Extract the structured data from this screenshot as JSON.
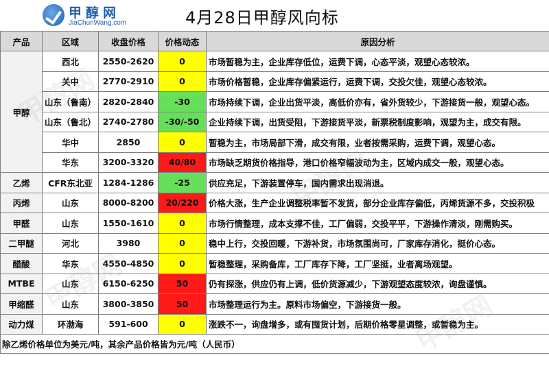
{
  "logo": {
    "cn": "甲醇网",
    "en": "JiaChunWang.com"
  },
  "title": "4月28日甲醇风向标",
  "headers": {
    "product": "产品",
    "region": "区域",
    "price": "收盘价格",
    "change": "价格动态",
    "reason": "原因分析"
  },
  "methanol_label": "甲醇",
  "rows": [
    {
      "region": "西北",
      "price": "2550-2620",
      "change": "0",
      "color": "yellow",
      "reason": "市场暂稳为主，企业库存低位，运费下调，心态平淡，观望心态较浓。"
    },
    {
      "region": "关中",
      "price": "2770-2910",
      "change": "0",
      "color": "yellow",
      "reason": "市场价格暂稳，企业库存偏紧运行，运费下调，交投欠佳，观望心态较浓。"
    },
    {
      "region": "山东（鲁南）",
      "price": "2820-2840",
      "change": "-30",
      "color": "green",
      "reason": "市场持续下调，企业出货平淡，高低价亦有，省外货较少，下游接货一般，观望心态。"
    },
    {
      "region": "山东（鲁北）",
      "price": "2740-2780",
      "change": "-30/-50",
      "color": "green",
      "reason": "企业持续下调，出货受阻，下游接货平淡，新票税制度影响，观望为主，成交有限。"
    },
    {
      "region": "华中",
      "price": "2850",
      "change": "0",
      "color": "yellow",
      "reason": "暂稳为主，市场局部下滑，成交有限，业者按需采购，运费下调，观望心态。"
    },
    {
      "region": "华东",
      "price": "3200-3320",
      "change": "40/80",
      "color": "red",
      "reason": "市场缺乏期货价格指导，港口价格窄幅波动为主，区域内成交一般，观望心态。"
    }
  ],
  "other_rows": [
    {
      "product": "乙烯",
      "region": "CFR东北亚",
      "price": "1284-1286",
      "change": "-25",
      "color": "green",
      "reason": "供应充足，下游装置停车，国内需求出现消退。"
    },
    {
      "product": "丙烯",
      "region": "山东",
      "price": "8000-8200",
      "change": "20/220",
      "color": "red",
      "reason": "价格大涨，生产企业调整税率暂不发货，部分企业库存偏低，丙烯货源不多，交投积极"
    },
    {
      "product": "甲醛",
      "region": "山东",
      "price": "1550-1610",
      "change": "0",
      "color": "yellow",
      "reason": "市场行情整理，成本支撑不佳，工厂偏弱，交投平平，下游操作清淡，刚需购买。"
    },
    {
      "product": "二甲醚",
      "region": "河北",
      "price": "3980",
      "change": "0",
      "color": "yellow",
      "reason": "稳中上行，交投回暖，下游补货，市场氛围尚可，厂家库存消化，挺价心态。"
    },
    {
      "product": "醋酸",
      "region": "华东",
      "price": "4550-4850",
      "change": "0",
      "color": "yellow",
      "reason": "暂稳整理，采购备库，工厂库存下降，工厂坚挺，业者离场观望。"
    },
    {
      "product": "MTBE",
      "region": "山东",
      "price": "6150-6250",
      "change": "50",
      "color": "red",
      "reason": "仍有探涨，供应仍有上调，低价货源减少，下游观望态度较浓，询盘谨慎。"
    },
    {
      "product": "甲缩醛",
      "region": "山东",
      "price": "3800-3850",
      "change": "50",
      "color": "red",
      "reason": "市场整理运行为主。原料市场偏空，下游接货一般。"
    },
    {
      "product": "动力煤",
      "region": "环渤海",
      "price": "591-600",
      "change": "0",
      "color": "yellow",
      "reason": "涨跌不一，询盘增多，或有囤货计划，后期价格零星调整，或暂稳为主。"
    }
  ],
  "footnote": "除乙烯价格单位为美元/吨，其余产品价格皆为元/吨（人民币）",
  "colors": {
    "green": "#66e05a",
    "yellow": "#ffff00",
    "red": "#ff1a1a",
    "header_bg": "#d9d9d9"
  }
}
